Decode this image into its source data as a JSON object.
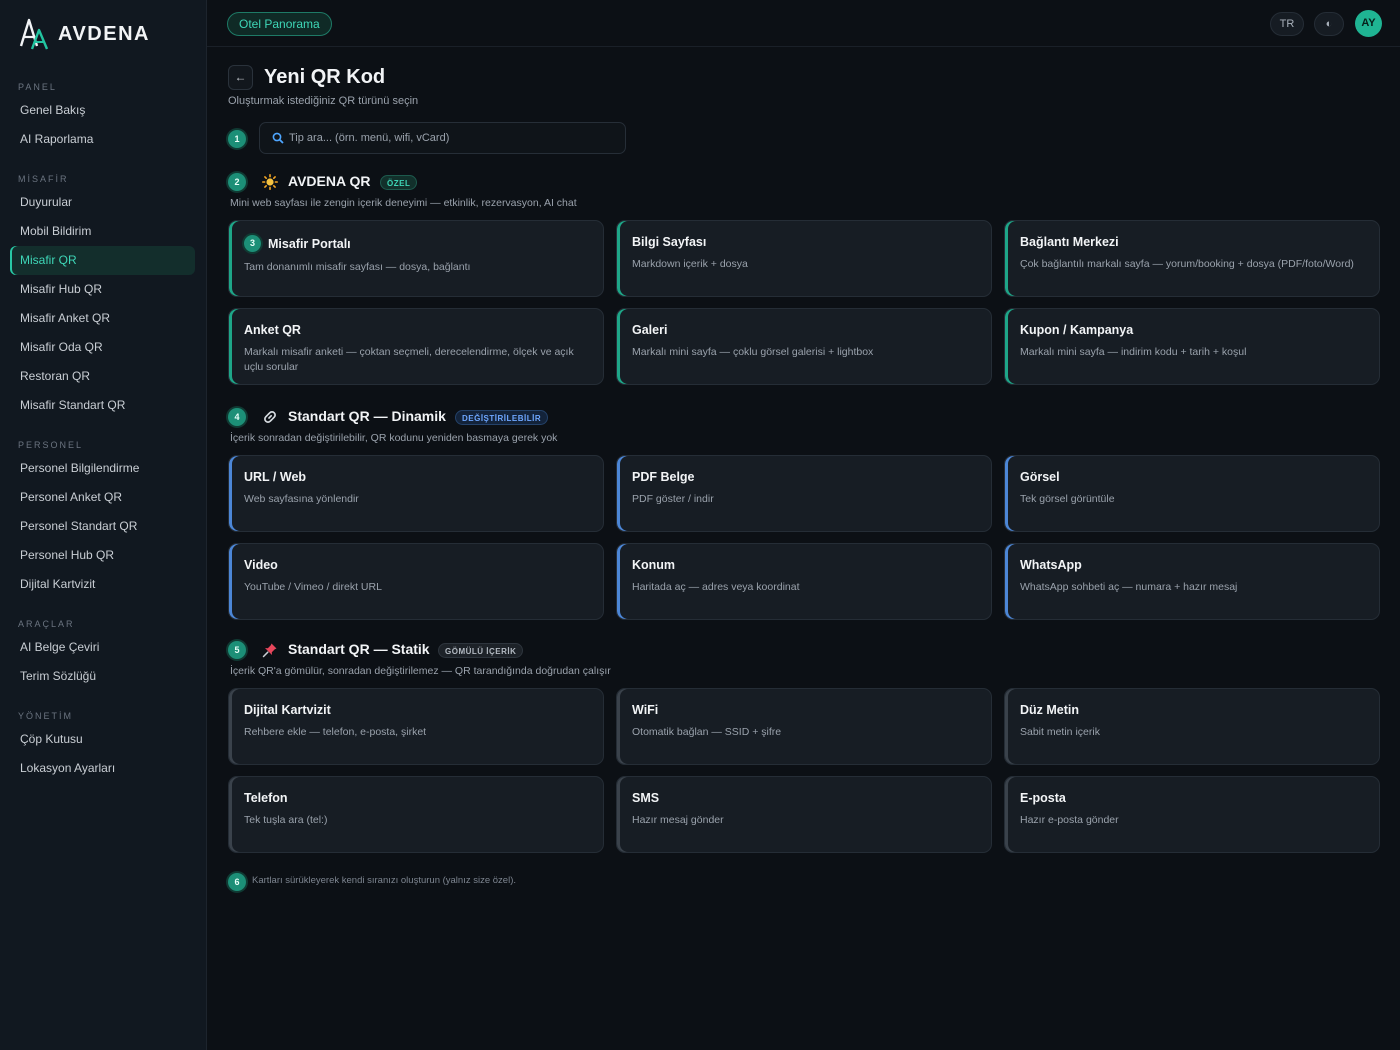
{
  "brand": {
    "name": "AVDENA"
  },
  "sidebar": {
    "sections": [
      {
        "label": "PANEL",
        "items": [
          "Genel Bakış",
          "AI Raporlama"
        ]
      },
      {
        "label": "MİSAFİR",
        "items": [
          "Duyurular",
          "Mobil Bildirim",
          "Misafir QR",
          "Misafir Hub QR",
          "Misafir Anket QR",
          "Misafir Oda QR",
          "Restoran QR",
          "Misafir Standart QR"
        ]
      },
      {
        "label": "PERSONEL",
        "items": [
          "Personel Bilgilendirme",
          "Personel Anket QR",
          "Personel Standart QR",
          "Personel Hub QR",
          "Dijital Kartvizit"
        ]
      },
      {
        "label": "ARAÇLAR",
        "items": [
          "AI Belge Çeviri",
          "Terim Sözlüğü"
        ]
      },
      {
        "label": "YÖNETİM",
        "items": [
          "Çöp Kutusu",
          "Lokasyon Ayarları"
        ]
      }
    ],
    "active": "Misafir QR"
  },
  "topbar": {
    "hotel": "Otel Panorama",
    "lang": "TR",
    "theme_icon": "◐",
    "avatar": "AY"
  },
  "page": {
    "back": "←",
    "title": "Yeni QR Kod",
    "subtitle": "Oluşturmak istediğiniz QR türünü seçin"
  },
  "steps": [
    "1",
    "2",
    "3",
    "4",
    "5",
    "6"
  ],
  "search": {
    "placeholder": "Tip ara... (örn. menü, wifi, vCard)"
  },
  "sections": [
    {
      "title": "AVDENA QR",
      "tag": "ÖZEL",
      "icon": "sun-icon",
      "desc": "Mini web sayfası ile zengin içerik deneyimi — etkinlik, rezervasyon, AI chat",
      "cards": [
        {
          "title": "Misafir Portalı",
          "desc": "Tam donanımlı misafir sayfası — dosya, bağlantı"
        },
        {
          "title": "Bilgi Sayfası",
          "desc": "Markdown içerik + dosya"
        },
        {
          "title": "Bağlantı Merkezi",
          "desc": "Çok bağlantılı markalı sayfa — yorum/booking + dosya (PDF/foto/Word)"
        },
        {
          "title": "Anket QR",
          "desc": "Markalı misafir anketi — çoktan seçmeli, derecelendirme, ölçek ve açık uçlu sorular"
        },
        {
          "title": "Galeri",
          "desc": "Markalı mini sayfa — çoklu görsel galerisi + lightbox"
        },
        {
          "title": "Kupon / Kampanya",
          "desc": "Markalı mini sayfa — indirim kodu + tarih + koşul"
        }
      ]
    },
    {
      "title": "Standart QR — Dinamik",
      "tag": "DEĞİŞTİRİLEBİLİR",
      "icon": "link-icon",
      "desc": "İçerik sonradan değiştirilebilir, QR kodunu yeniden basmaya gerek yok",
      "cards": [
        {
          "title": "URL / Web",
          "desc": "Web sayfasına yönlendir"
        },
        {
          "title": "PDF Belge",
          "desc": "PDF göster / indir"
        },
        {
          "title": "Görsel",
          "desc": "Tek görsel görüntüle"
        },
        {
          "title": "Video",
          "desc": "YouTube / Vimeo / direkt URL"
        },
        {
          "title": "Konum",
          "desc": "Haritada aç — adres veya koordinat"
        },
        {
          "title": "WhatsApp",
          "desc": "WhatsApp sohbeti aç — numara + hazır mesaj"
        }
      ]
    },
    {
      "title": "Standart QR — Statik",
      "tag": "GÖMÜLÜ İÇERİK",
      "icon": "pin-icon",
      "desc": "İçerik QR'a gömülür, sonradan değiştirilemez — QR tarandığında doğrudan çalışır",
      "cards": [
        {
          "title": "Dijital Kartvizit",
          "desc": "Rehbere ekle — telefon, e-posta, şirket"
        },
        {
          "title": "WiFi",
          "desc": "Otomatik bağlan — SSID + şifre"
        },
        {
          "title": "Düz Metin",
          "desc": "Sabit metin içerik"
        },
        {
          "title": "Telefon",
          "desc": "Tek tuşla ara (tel:)"
        },
        {
          "title": "SMS",
          "desc": "Hazır mesaj gönder"
        },
        {
          "title": "E-posta",
          "desc": "Hazır e-posta gönder"
        }
      ]
    }
  ],
  "footer": {
    "note": "Kartları sürükleyerek kendi sıranızı oluşturun (yalnız size özel)."
  },
  "colors": {
    "accent": "#1ea688",
    "blue_accent": "#4c86d6",
    "background": "#0c1015",
    "card": "#171d24"
  }
}
